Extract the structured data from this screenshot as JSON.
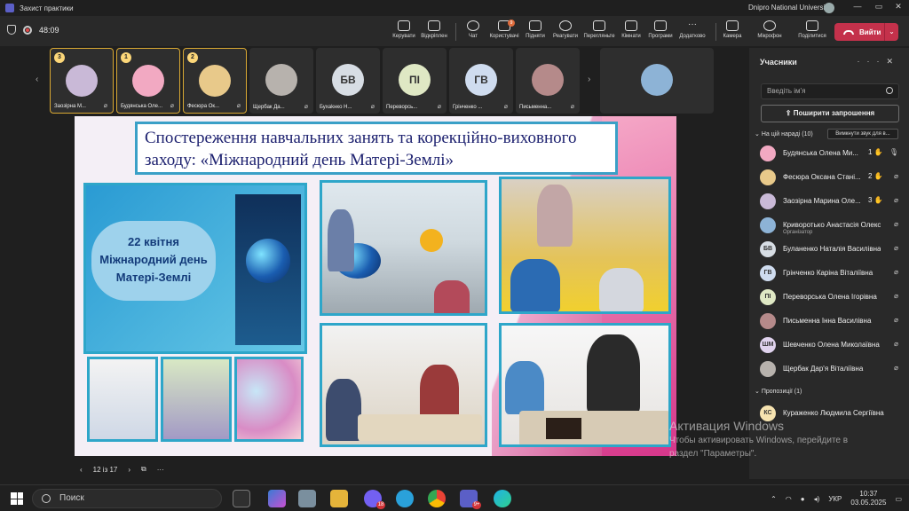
{
  "window": {
    "title": "Захист практики",
    "org": "Dnipro National University",
    "controls": [
      "—",
      "▭",
      "✕"
    ]
  },
  "toolbar": {
    "timer": "48:09",
    "buttons": [
      {
        "id": "control",
        "label": "Керувати"
      },
      {
        "id": "share",
        "label": "Відкріплен"
      },
      {
        "id": "chat",
        "label": "Чат"
      },
      {
        "id": "people",
        "label": "Користувачі",
        "badge": "9"
      },
      {
        "id": "raise",
        "label": "Підняти"
      },
      {
        "id": "react",
        "label": "Реагувати"
      },
      {
        "id": "view",
        "label": "Перегляньте"
      },
      {
        "id": "rooms",
        "label": "Кімнати"
      },
      {
        "id": "apps",
        "label": "Програми"
      },
      {
        "id": "more",
        "label": "Додатково"
      },
      {
        "id": "camera",
        "label": "Камера"
      },
      {
        "id": "mic",
        "label": "Мікрофон"
      },
      {
        "id": "present",
        "label": "Поділитися"
      }
    ],
    "leave_label": "Вийти"
  },
  "gallery": {
    "tiles": [
      {
        "name": "Заозірна М...",
        "hand": "3",
        "initials": "",
        "color": "#c9b9d7",
        "active": true
      },
      {
        "name": "Будянська Оле...",
        "hand": "1",
        "initials": "",
        "color": "#f2a9c2",
        "active": true
      },
      {
        "name": "Фесюра Ок...",
        "hand": "2",
        "initials": "",
        "color": "#e8c98a",
        "active": true
      },
      {
        "name": "Щербак Да...",
        "hand": "",
        "initials": "",
        "color": "#b7b2ad",
        "active": false
      },
      {
        "name": "Бухаkнко Н...",
        "hand": "",
        "initials": "БВ",
        "color": "#d7dde4",
        "active": false
      },
      {
        "name": "Переворсь...",
        "hand": "",
        "initials": "ПІ",
        "color": "#dfe8c4",
        "active": false
      },
      {
        "name": "Грінченко ...",
        "hand": "",
        "initials": "ГВ",
        "color": "#cfdcef",
        "active": false
      },
      {
        "name": "Письменна...",
        "hand": "",
        "initials": "",
        "color": "#b58a8a",
        "active": false
      },
      {
        "name": "",
        "hand": "",
        "initials": "",
        "color": "#8db3d6",
        "active": false
      }
    ]
  },
  "slide": {
    "title": "Спостереження навчальних занять та корекційно-виховного заходу: «Міжнародний день Матері-Землі»",
    "poster_text": "22 квітня Міжнародний день Матері-Землі",
    "page": "12 із 17"
  },
  "participants": {
    "header": "Учасники",
    "search_placeholder": "Введіть ім'я",
    "invite_label": "Поширити запрошення",
    "in_meeting_label": "На цій нараді (10)",
    "mute_all_label": "Вимкнути звук для в...",
    "people": [
      {
        "name": "Будянська Олена Ми...",
        "num": "1",
        "role": "",
        "initials": "",
        "color": "#f2a9c2",
        "mic": "on"
      },
      {
        "name": "Фесюра Оксана Стані...",
        "num": "2",
        "role": "",
        "initials": "",
        "color": "#e8c98a",
        "mic": "off"
      },
      {
        "name": "Заозірна Марина Оле...",
        "num": "3",
        "role": "",
        "initials": "",
        "color": "#c9b9d7",
        "mic": "off"
      },
      {
        "name": "Криворотько Анастасія Олекс...",
        "num": "",
        "role": "Організатор",
        "initials": "",
        "color": "#8db3d6",
        "mic": "off"
      },
      {
        "name": "Буланенко Наталія Василівна",
        "num": "",
        "role": "",
        "initials": "БВ",
        "color": "#d7dde4",
        "mic": "off"
      },
      {
        "name": "Грінченко Каріна Віталіївна",
        "num": "",
        "role": "",
        "initials": "ГВ",
        "color": "#cfdcef",
        "mic": "off"
      },
      {
        "name": "Переворська Олена Ігорівна",
        "num": "",
        "role": "",
        "initials": "ПІ",
        "color": "#dfe8c4",
        "mic": "off"
      },
      {
        "name": "Письменна Інна Василівна",
        "num": "",
        "role": "",
        "initials": "",
        "color": "#b58a8a",
        "mic": "off"
      },
      {
        "name": "Шевченко Олена Миколаївна",
        "num": "",
        "role": "",
        "initials": "ШМ",
        "color": "#e0d3ee",
        "mic": "off"
      },
      {
        "name": "Щербак Дар'я Віталіївна",
        "num": "",
        "role": "",
        "initials": "",
        "color": "#b7b2ad",
        "mic": "off"
      }
    ],
    "suggestions_label": "Пропозиції (1)",
    "suggested": [
      {
        "name": "Кураженко Людмила Сергіївна",
        "initials": "КС",
        "color": "#f6e3b0"
      }
    ]
  },
  "watermark": {
    "line1": "Активация Windows",
    "line2": "Чтобы активировать Windows, перейдите в",
    "line3": "раздел \"Параметры\"."
  },
  "taskbar": {
    "search_label": "Поиск",
    "badges": {
      "viber": "18",
      "teams": "9+"
    },
    "lang": "УКР",
    "time": "10:37",
    "date": "03.05.2025"
  }
}
